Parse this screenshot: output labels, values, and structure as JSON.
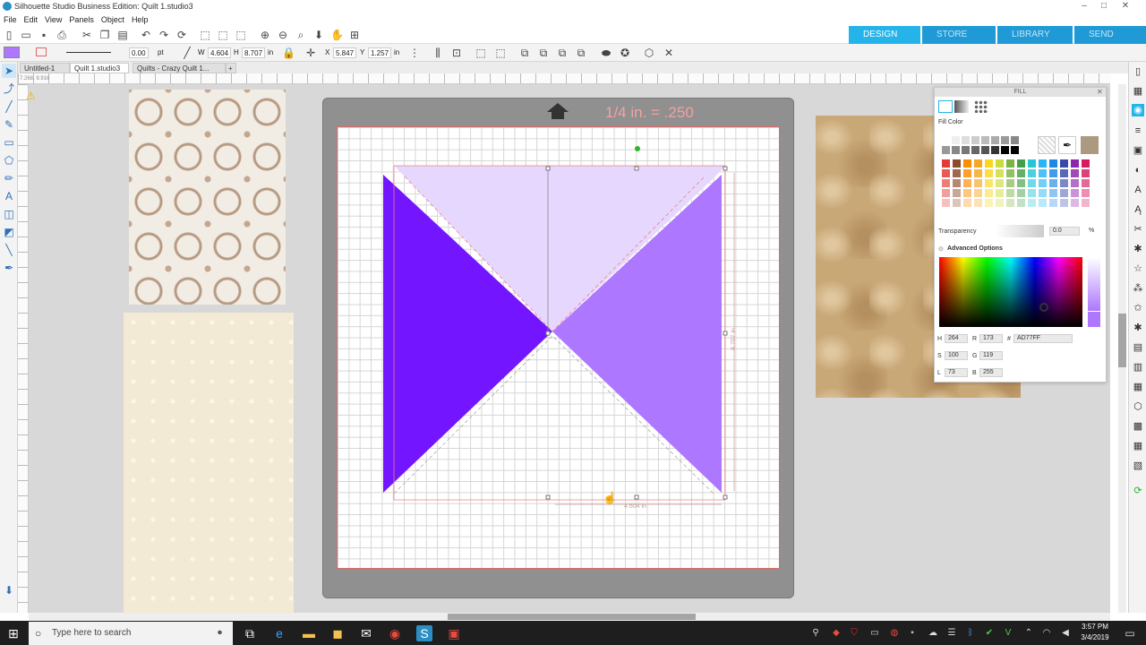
{
  "window": {
    "title": "Silhouette Studio Business Edition: Quilt 1.studio3",
    "minimize": "–",
    "maximize": "□",
    "close": "✕"
  },
  "menu": [
    "File",
    "Edit",
    "View",
    "Panels",
    "Object",
    "Help"
  ],
  "nav_tabs": [
    {
      "label": "DESIGN",
      "active": true
    },
    {
      "label": "STORE",
      "active": false
    },
    {
      "label": "LIBRARY",
      "active": false
    },
    {
      "label": "SEND",
      "active": false
    }
  ],
  "props": {
    "line_weight": "0.00",
    "line_unit": "pt",
    "w_label": "W",
    "w_value": "4.604",
    "h_label": "H",
    "h_value": "8.707",
    "size_unit": "in",
    "x_label": "X",
    "x_value": "5.847",
    "y_label": "Y",
    "y_value": "1.257",
    "pos_unit": "in"
  },
  "doc_tabs": [
    {
      "label": "Untitled-1",
      "active": false
    },
    {
      "label": "Quilt 1.studio3",
      "active": true
    },
    {
      "label": "Quilts - Crazy Quilt 1...",
      "active": false
    }
  ],
  "ruler_readout": "7.268, 9.916",
  "mat": {
    "scale_label": "1/4 in. = .250",
    "width_label": "4.604 in",
    "height_label": "8.707 in"
  },
  "fill_panel": {
    "title": "FILL",
    "section_label": "Fill Color",
    "transparency_label": "Transparency",
    "transparency_value": "0.0",
    "transparency_unit": "%",
    "advanced_label": "Advanced Options",
    "H_label": "H",
    "H": "264",
    "S_label": "S",
    "S": "100",
    "L_label": "L",
    "L": "73",
    "R_label": "R",
    "R": "173",
    "G_label": "G",
    "G": "119",
    "B_label": "B",
    "B": "255",
    "hex_label": "#",
    "hex": "AD77FF"
  },
  "colors": {
    "dark_purple": "#7316ff",
    "light_purple": "#ad77ff",
    "lavender": "#e6d7ff",
    "accent": "#24b4e9"
  },
  "taskbar": {
    "search_placeholder": "Type here to search",
    "time": "3:57 PM",
    "date": "3/4/2019"
  }
}
